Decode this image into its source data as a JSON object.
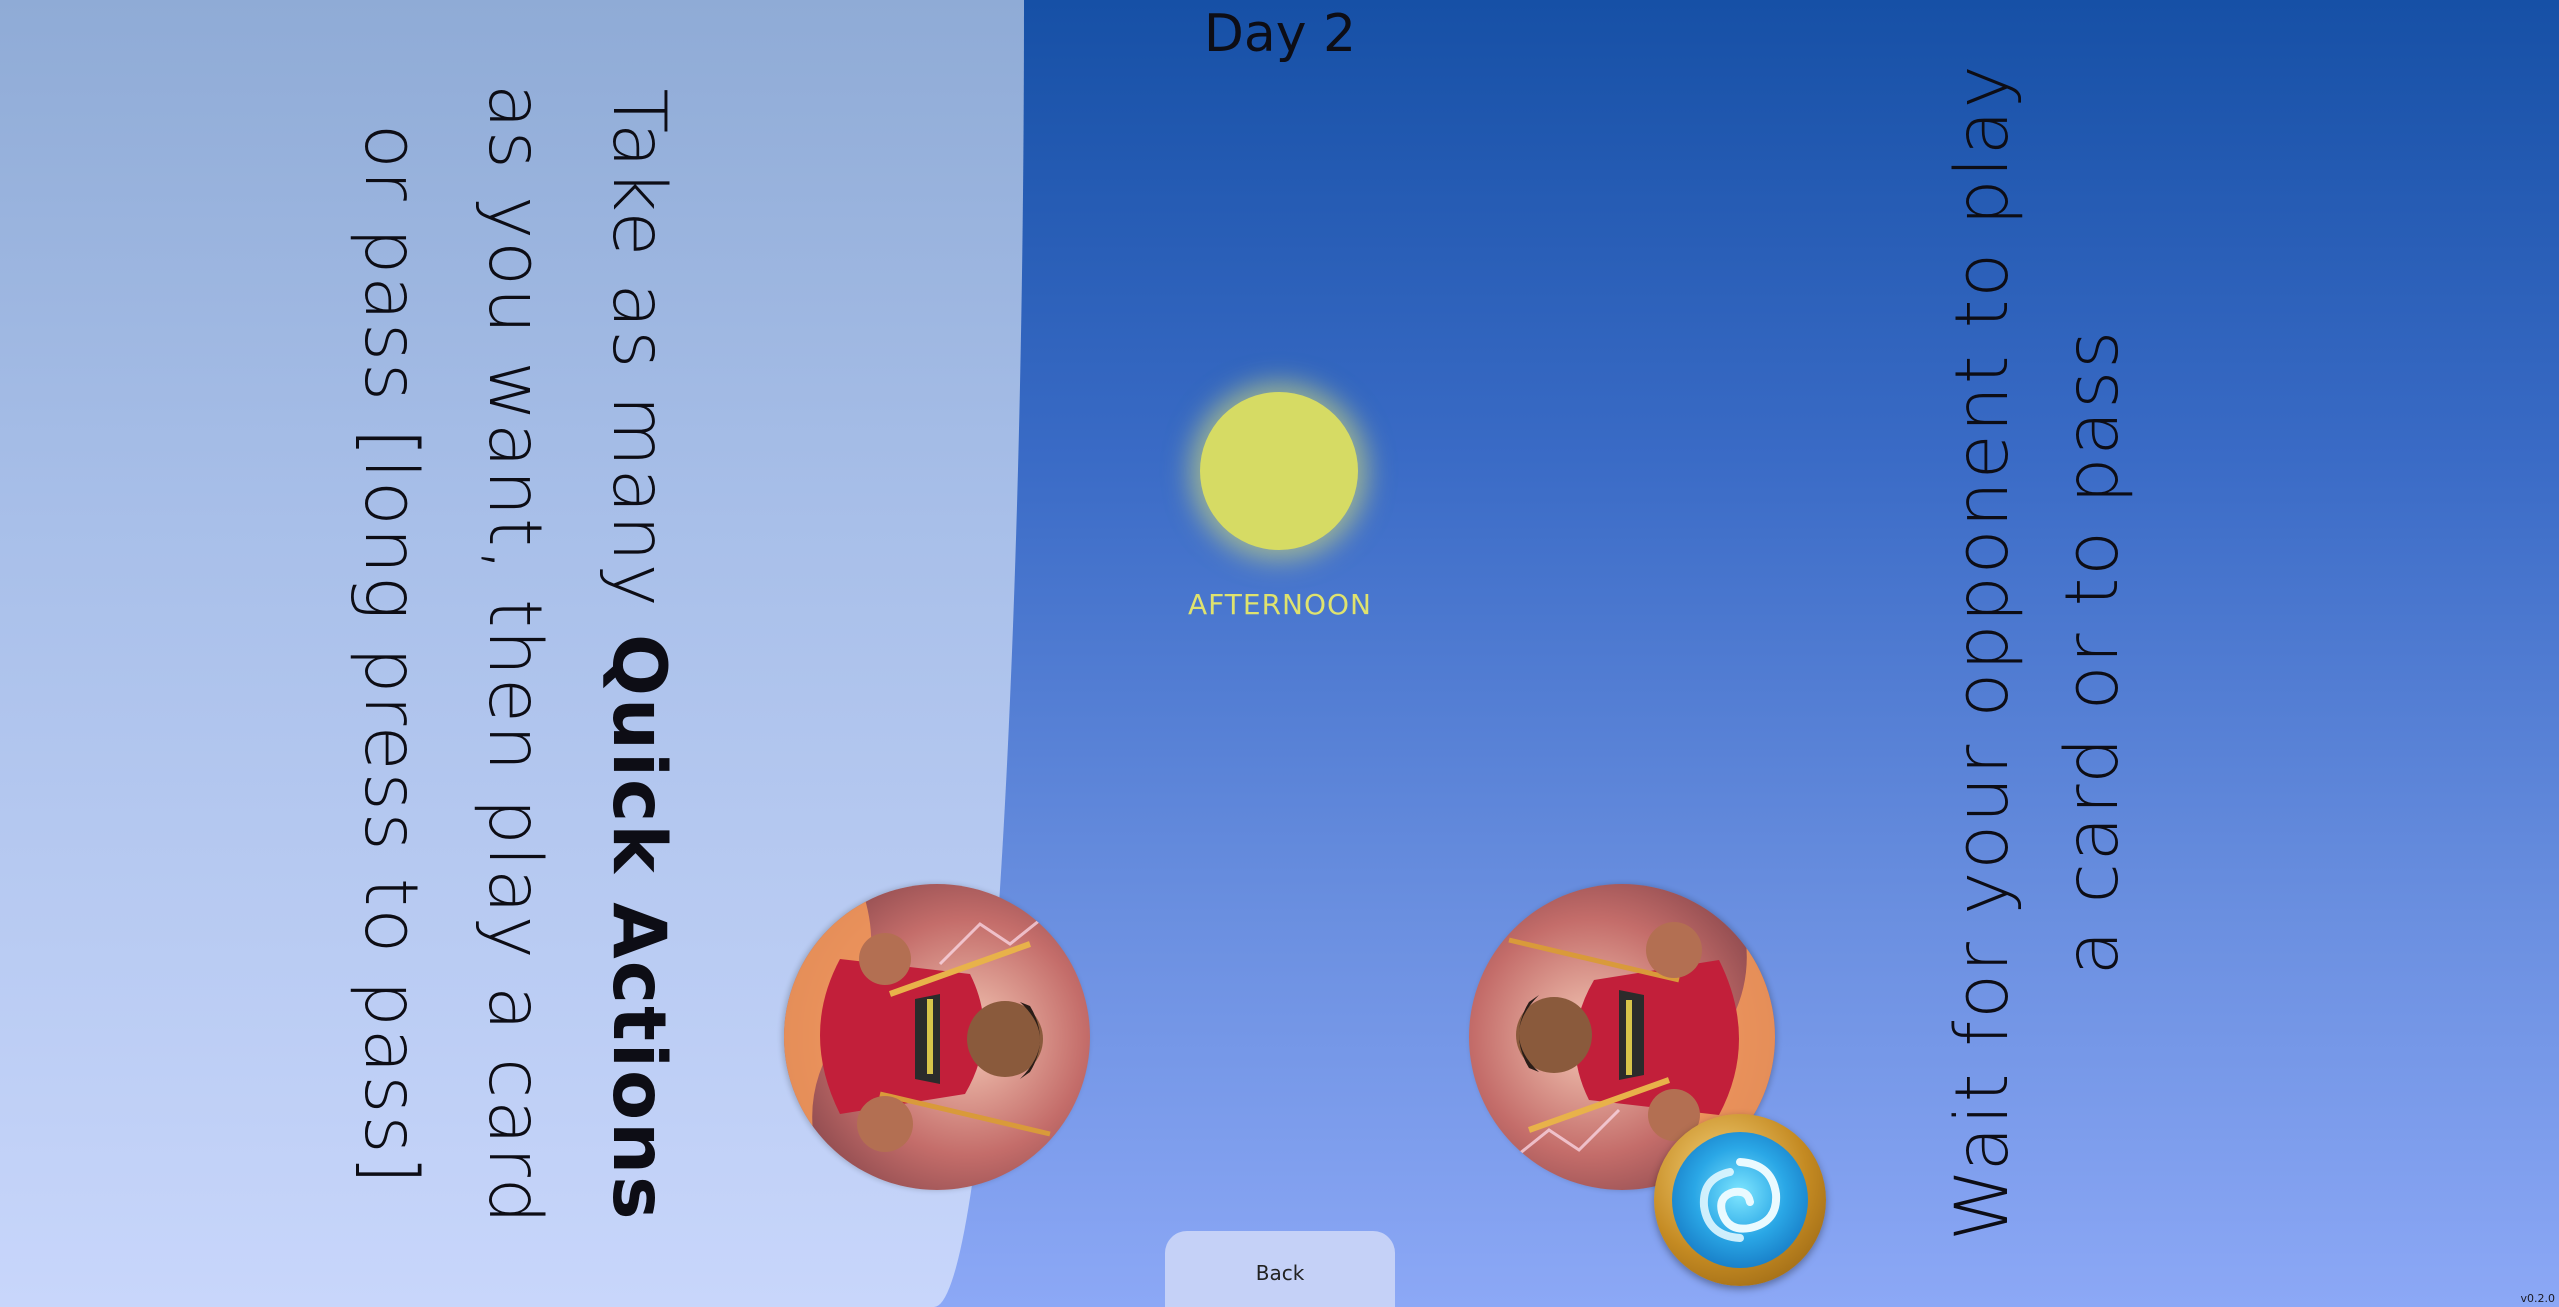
{
  "header": {
    "day_label": "Day 2"
  },
  "time_of_day": {
    "phase_label": "AFTERNOON",
    "sun_color": "#d6db64",
    "label_color": "#dfe36e"
  },
  "left_panel": {
    "text_before": "Take as many ",
    "text_bold": "Quick Actions",
    "text_after": " as you want, then play a card or pass [long press to pass]",
    "background_color": "#a8bfe9"
  },
  "right_panel": {
    "text": "Wait for your opponent to play a card or to pass"
  },
  "portraits": {
    "player": {
      "icon": "warrior-portrait-icon"
    },
    "opponent": {
      "icon": "warrior-portrait-icon"
    }
  },
  "faction_badge": {
    "icon": "water-swirl-icon"
  },
  "footer": {
    "back_label": "Back",
    "version": "v0.2.0"
  },
  "colors": {
    "sky_top": "#1650a6",
    "sky_bottom": "#8ca8f6",
    "back_button": "#c5d1f7"
  }
}
